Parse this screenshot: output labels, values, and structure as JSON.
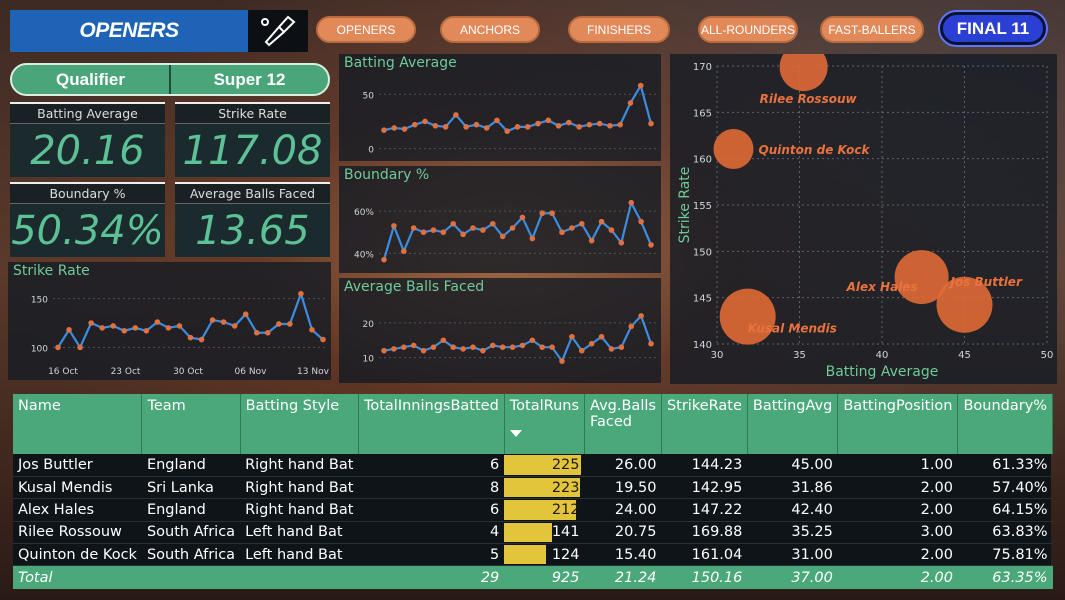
{
  "header": {
    "title": "OPENERS",
    "final_label": "FINAL 11"
  },
  "nav": [
    "OPENERS",
    "ANCHORS",
    "FINISHERS",
    "ALL-ROUNDERS",
    "FAST-BALLERS"
  ],
  "stage_toggle": [
    "Qualifier",
    "Super 12"
  ],
  "kpis": [
    {
      "label": "Batting Average",
      "value": "20.16"
    },
    {
      "label": "Strike Rate",
      "value": "117.08"
    },
    {
      "label": "Boundary %",
      "value": "50.34%"
    },
    {
      "label": "Average Balls Faced",
      "value": "13.65"
    }
  ],
  "chart_data": [
    {
      "type": "line",
      "title": "Strike Rate",
      "color": "#3c8de0",
      "marker": "#e07040",
      "x_tick_labels": [
        "16 Oct",
        "23 Oct",
        "30 Oct",
        "06 Nov",
        "13 Nov"
      ],
      "y_ticks": [
        100,
        150
      ],
      "ylim": [
        85,
        165
      ],
      "values": [
        100,
        118,
        100,
        125,
        120,
        122,
        117,
        120,
        117,
        126,
        120,
        122,
        110,
        108,
        128,
        126,
        122,
        134,
        115,
        115,
        124,
        124,
        155,
        118,
        108
      ]
    },
    {
      "type": "line",
      "title": "Batting Average",
      "color": "#3c8de0",
      "marker": "#e07040",
      "y_ticks": [
        0,
        50
      ],
      "ylim": [
        -5,
        65
      ],
      "values": [
        17,
        19,
        18,
        22,
        25,
        21,
        20,
        31,
        20,
        22,
        19,
        26,
        16,
        20,
        20,
        23,
        26,
        21,
        24,
        20,
        22,
        23,
        21,
        22,
        42,
        58,
        23
      ]
    },
    {
      "type": "line",
      "title": "Boundary %",
      "color": "#3c8de0",
      "marker": "#e07040",
      "y_ticks": [
        "40%",
        "60%"
      ],
      "y_tick_values": [
        40,
        60
      ],
      "ylim": [
        34,
        70
      ],
      "values": [
        37,
        53,
        41,
        52,
        50,
        51,
        50,
        54,
        49,
        52,
        51,
        54,
        48,
        52,
        57,
        47,
        59,
        59,
        50,
        52,
        54,
        46,
        55,
        51,
        45,
        64,
        55,
        44
      ]
    },
    {
      "type": "line",
      "title": "Average Balls Faced",
      "color": "#3c8de0",
      "marker": "#e07040",
      "y_ticks": [
        10,
        20
      ],
      "ylim": [
        5,
        26
      ],
      "values": [
        12,
        12.5,
        13,
        13.5,
        12,
        13,
        15,
        13,
        12.5,
        13,
        12,
        13.5,
        13,
        13,
        13.5,
        15,
        13,
        13,
        9,
        16,
        12,
        14,
        16,
        12.5,
        13,
        19,
        22,
        14
      ]
    },
    {
      "type": "scatter",
      "xlabel": "Batting Average",
      "ylabel": "Strike Rate",
      "xlim": [
        30,
        50
      ],
      "ylim": [
        140,
        170
      ],
      "x_ticks": [
        30,
        35,
        40,
        45,
        50
      ],
      "y_ticks": [
        140,
        145,
        150,
        155,
        160,
        165,
        170
      ],
      "point_color": "#e06a35",
      "points": [
        {
          "name": "Rilee Rossouw",
          "x": 35.25,
          "y": 169.88,
          "r": 24
        },
        {
          "name": "Quinton de Kock",
          "x": 31.0,
          "y": 161.04,
          "r": 20
        },
        {
          "name": "Jos Buttler",
          "x": 45.0,
          "y": 144.23,
          "r": 28
        },
        {
          "name": "Alex Hales",
          "x": 42.4,
          "y": 147.22,
          "r": 27
        },
        {
          "name": "Kusal Mendis",
          "x": 31.86,
          "y": 142.95,
          "r": 28
        }
      ]
    }
  ],
  "table": {
    "headers": [
      "Name",
      "Team",
      "Batting Style",
      "TotalInningsBatted",
      "TotalRuns",
      "Avg.Balls Faced",
      "StrikeRate",
      "BattingAvg",
      "BattingPosition",
      "Boundary%"
    ],
    "rows": [
      [
        "Jos Buttler",
        "England",
        "Right hand Bat",
        "6",
        "225",
        "26.00",
        "144.23",
        "45.00",
        "1.00",
        "61.33%"
      ],
      [
        "Kusal Mendis",
        "Sri Lanka",
        "Right hand Bat",
        "8",
        "223",
        "19.50",
        "142.95",
        "31.86",
        "2.00",
        "57.40%"
      ],
      [
        "Alex Hales",
        "England",
        "Right hand Bat",
        "6",
        "212",
        "24.00",
        "147.22",
        "42.40",
        "2.00",
        "64.15%"
      ],
      [
        "Rilee Rossouw",
        "South Africa",
        "Left hand Bat",
        "4",
        "141",
        "20.75",
        "169.88",
        "35.25",
        "3.00",
        "63.83%"
      ],
      [
        "Quinton de Kock",
        "South Africa",
        "Left hand Bat",
        "5",
        "124",
        "15.40",
        "161.04",
        "31.00",
        "2.00",
        "75.81%"
      ]
    ],
    "run_max": 225,
    "total": [
      "Total",
      "",
      "",
      "29",
      "925",
      "21.24",
      "150.16",
      "37.00",
      "2.00",
      "63.35%"
    ]
  }
}
